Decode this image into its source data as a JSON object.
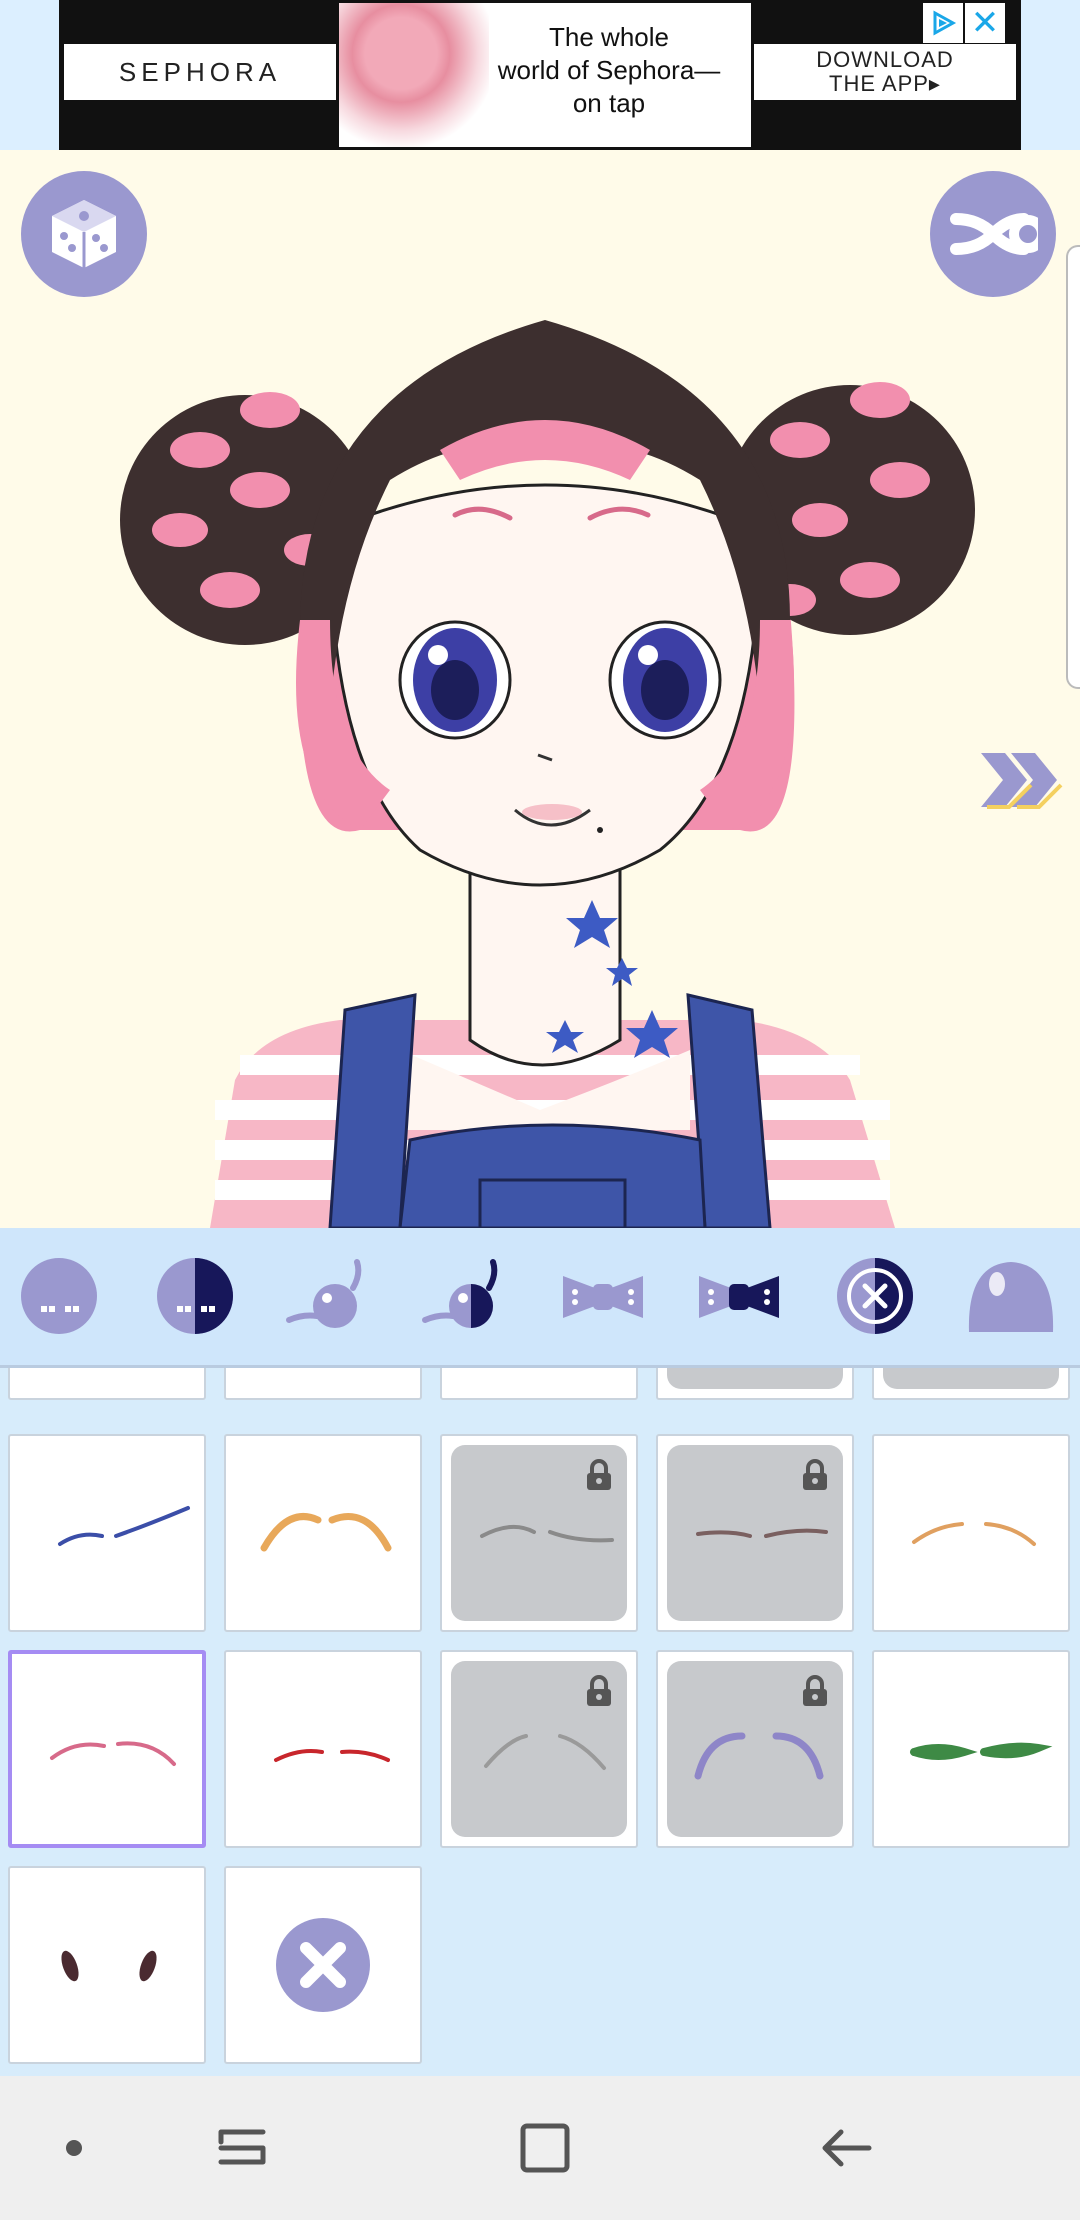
{
  "ad": {
    "brand": "SEPHORA",
    "headline_lines": [
      "The whole",
      "world of Sephora—",
      "on tap"
    ],
    "cta_lines": [
      "DOWNLOAD",
      "THE APP▸"
    ],
    "close_symbol": "✕"
  },
  "avatar": {
    "random_button_icon": "dice-icon",
    "shuffle_button_icon": "shuffle-icon",
    "next_icon": "double-chevron-right-icon"
  },
  "categories": [
    {
      "icon": "face-base-icon"
    },
    {
      "icon": "face-shade-icon"
    },
    {
      "icon": "eye-icon"
    },
    {
      "icon": "eye-shade-icon"
    },
    {
      "icon": "bow-icon"
    },
    {
      "icon": "bow-shade-icon"
    },
    {
      "icon": "none-circle-icon"
    },
    {
      "icon": "hair-blob-icon"
    }
  ],
  "grid": {
    "tiles": [
      {
        "row": 0,
        "col": 0,
        "locked": false,
        "color": "#3b4ea8",
        "shape": "thin-straight"
      },
      {
        "row": 0,
        "col": 1,
        "locked": false,
        "color": "#e8a85a",
        "shape": "arched-thick"
      },
      {
        "row": 0,
        "col": 2,
        "locked": true,
        "color": "#8a8a8a",
        "shape": "curved-thin"
      },
      {
        "row": 0,
        "col": 3,
        "locked": true,
        "color": "#7a6060",
        "shape": "flat-soft"
      },
      {
        "row": 0,
        "col": 4,
        "locked": false,
        "color": "#e0a060",
        "shape": "angled-thin"
      },
      {
        "row": 1,
        "col": 0,
        "locked": false,
        "color": "#d76a8a",
        "shape": "arched-thin",
        "selected": true
      },
      {
        "row": 1,
        "col": 1,
        "locked": false,
        "color": "#c8262c",
        "shape": "short-flat"
      },
      {
        "row": 1,
        "col": 2,
        "locked": true,
        "color": "#9a9a9a",
        "shape": "hooked"
      },
      {
        "row": 1,
        "col": 3,
        "locked": true,
        "color": "#8e86c8",
        "shape": "high-arch"
      },
      {
        "row": 1,
        "col": 4,
        "locked": false,
        "color": "#3e8a45",
        "shape": "leaf"
      },
      {
        "row": 2,
        "col": 0,
        "locked": false,
        "color": "#4a2a30",
        "shape": "dots"
      },
      {
        "row": 2,
        "col": 1,
        "locked": false,
        "none": true,
        "icon": "close-icon"
      }
    ]
  },
  "nav": {
    "items": [
      {
        "icon": "dot-icon"
      },
      {
        "icon": "recents-icon"
      },
      {
        "icon": "home-icon"
      },
      {
        "icon": "back-icon"
      }
    ]
  }
}
